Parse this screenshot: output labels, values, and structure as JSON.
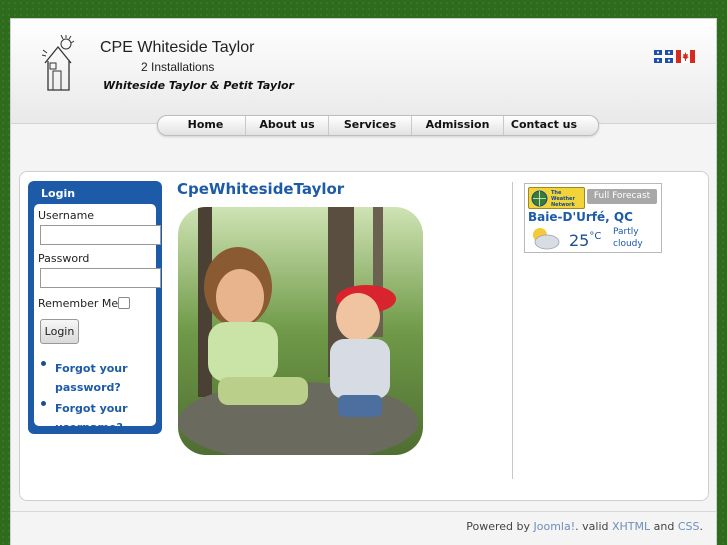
{
  "header": {
    "site_title": "CPE Whiteside Taylor",
    "subtitle": "2 Installations",
    "tagline": "Whiteside Taylor & Petit Taylor"
  },
  "nav": {
    "items": [
      {
        "label": "Home"
      },
      {
        "label": "About us"
      },
      {
        "label": "Services"
      },
      {
        "label": "Admission"
      },
      {
        "label": "Contact us"
      }
    ]
  },
  "login": {
    "title": "Login",
    "username_label": "Username",
    "username_value": "",
    "password_label": "Password",
    "password_value": "",
    "remember_label": "Remember Me",
    "remember_checked": false,
    "button_label": "Login",
    "forgot_password": "Forgot your password?",
    "forgot_username": "Forgot your username?"
  },
  "article": {
    "title": "CpeWhitesideTaylor"
  },
  "weather": {
    "brand_logo": "The Weather Network",
    "full_forecast": "Full Forecast",
    "city": "Baie-D'Urfé, QC",
    "temperature": "25",
    "unit": "°C",
    "condition": "Partly cloudy",
    "icon": "partly-cloudy-icon"
  },
  "footer": {
    "powered_by": "Powered by",
    "joomla": "Joomla!",
    "valid": ". valid",
    "xhtml": "XHTML",
    "and": "and",
    "css": "CSS",
    "end": "."
  },
  "colors": {
    "accent_blue": "#1d5aa8",
    "page_background": "#2f6b1c",
    "weather_yellow": "#f2d43a"
  }
}
